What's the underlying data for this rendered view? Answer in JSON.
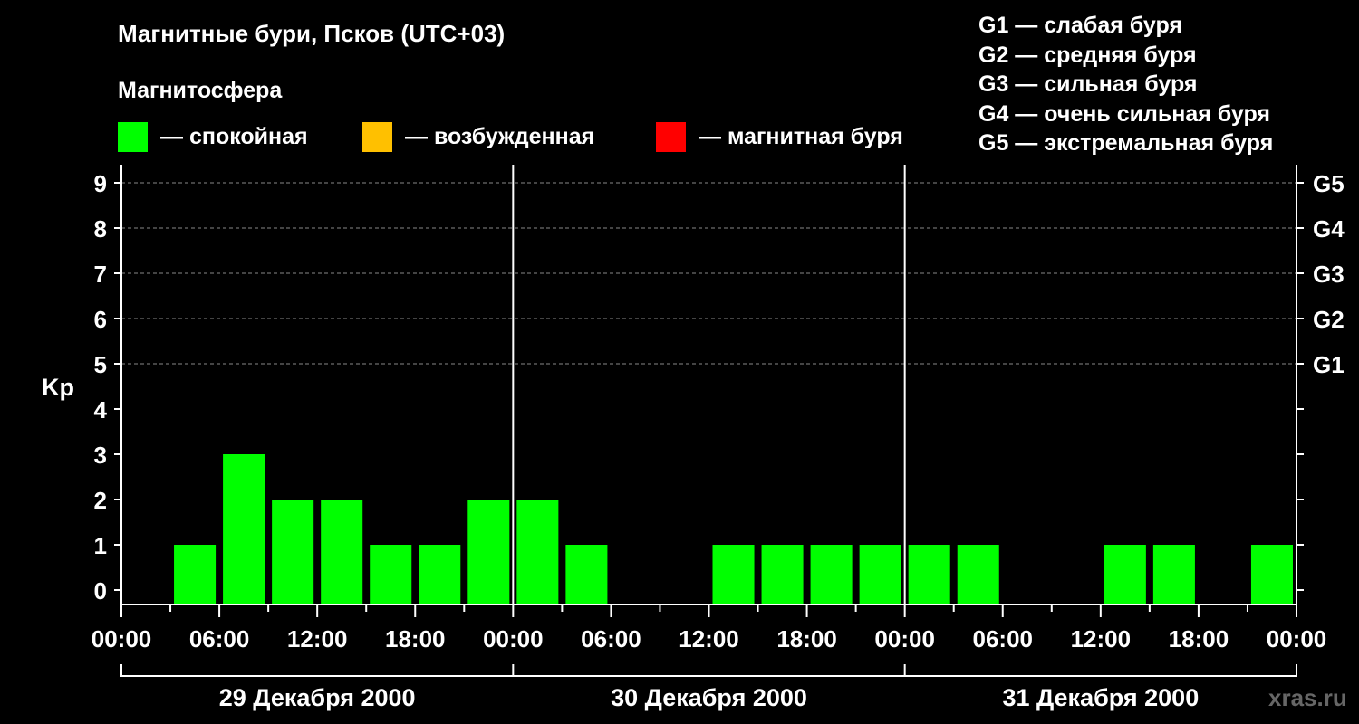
{
  "title": "Магнитные бури, Псков (UTC+03)",
  "magnetosphere_label": "Магнитосфера",
  "legend": [
    {
      "color": "#00ff00",
      "label": "— спокойная"
    },
    {
      "color": "#ffc000",
      "label": "— возбужденная"
    },
    {
      "color": "#ff0000",
      "label": "— магнитная буря"
    }
  ],
  "g_legend": [
    "G1 — слабая буря",
    "G2 — средняя буря",
    "G3 — сильная буря",
    "G4 — очень сильная буря",
    "G5 — экстремальная буря"
  ],
  "watermark": "xras.ru",
  "colors": {
    "quiet": "#00ff00",
    "active": "#ffc000",
    "storm": "#ff0000",
    "background": "#000000",
    "foreground": "#ffffff"
  },
  "chart_data": {
    "type": "bar",
    "ylabel": "Kp",
    "ylim": [
      0,
      9
    ],
    "y_ticks": [
      "0",
      "1",
      "2",
      "3",
      "4",
      "5",
      "6",
      "7",
      "8",
      "9"
    ],
    "right_ticks": [
      {
        "kp": 5,
        "label": "G1"
      },
      {
        "kp": 6,
        "label": "G2"
      },
      {
        "kp": 7,
        "label": "G3"
      },
      {
        "kp": 8,
        "label": "G4"
      },
      {
        "kp": 9,
        "label": "G5"
      }
    ],
    "grid": "dashed at Kp 5-9",
    "x_tick_labels": [
      "00:00",
      "06:00",
      "12:00",
      "18:00",
      "00:00",
      "06:00",
      "12:00",
      "18:00",
      "00:00",
      "06:00",
      "12:00",
      "18:00",
      "00:00"
    ],
    "days": [
      "29 Декабря 2000",
      "30 Декабря 2000",
      "31 Декабря 2000"
    ],
    "interval_hours": 3,
    "values": [
      0,
      1,
      3,
      2,
      2,
      1,
      1,
      2,
      2,
      1,
      0,
      0,
      1,
      1,
      1,
      1,
      1,
      1,
      0,
      0,
      1,
      1,
      0,
      1
    ]
  }
}
